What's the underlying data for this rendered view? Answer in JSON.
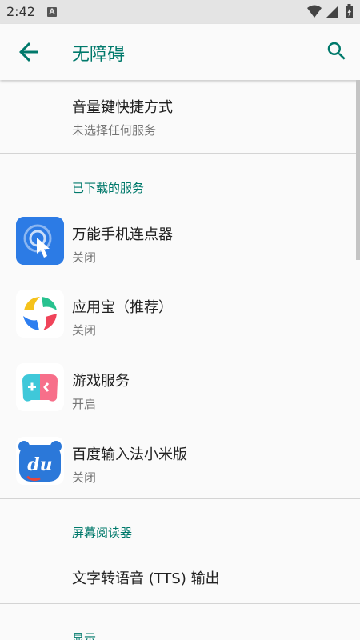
{
  "status_bar": {
    "time": "2:42",
    "badge": "A"
  },
  "app_bar": {
    "title": "无障碍"
  },
  "shortcut_item": {
    "title": "音量键快捷方式",
    "subtitle": "未选择任何服务"
  },
  "downloaded_section": {
    "header": "已下载的服务",
    "items": [
      {
        "title": "万能手机连点器",
        "subtitle": "关闭",
        "icon": "auto-clicker-app-icon"
      },
      {
        "title": "应用宝（推荐）",
        "subtitle": "关闭",
        "icon": "yingyongbao-app-icon"
      },
      {
        "title": "游戏服务",
        "subtitle": "开启",
        "icon": "game-service-app-icon"
      },
      {
        "title": "百度输入法小米版",
        "subtitle": "关闭",
        "icon": "baidu-input-app-icon"
      }
    ]
  },
  "screen_reader_section": {
    "header": "屏幕阅读器",
    "items": [
      {
        "title": "文字转语音 (TTS) 输出"
      }
    ]
  },
  "display_section": {
    "header": "显示"
  },
  "colors": {
    "accent": "#00796b",
    "status_bar_bg": "#e4e4e4",
    "background": "#fafafa"
  }
}
